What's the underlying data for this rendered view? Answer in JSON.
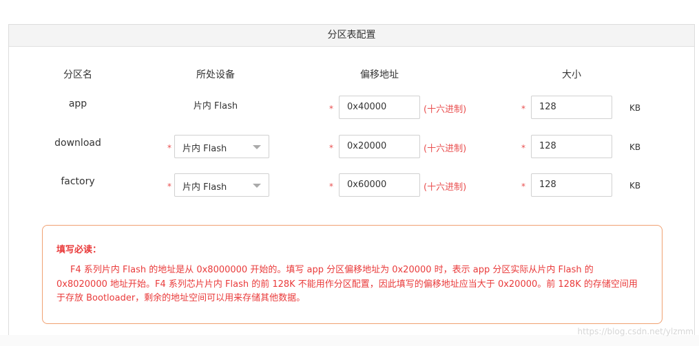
{
  "panel": {
    "title": "分区表配置"
  },
  "columns": {
    "name": "分区名",
    "device": "所处设备",
    "offset": "偏移地址",
    "size": "大小"
  },
  "rows": [
    {
      "name": "app",
      "device": "片内 Flash",
      "offset": "0x40000",
      "offset_hint": "(十六进制)",
      "size": "128",
      "unit": "KB"
    },
    {
      "name": "download",
      "device": "片内 Flash",
      "offset": "0x20000",
      "offset_hint": "(十六进制)",
      "size": "128",
      "unit": "KB"
    },
    {
      "name": "factory",
      "device": "片内 Flash",
      "offset": "0x60000",
      "offset_hint": "(十六进制)",
      "size": "128",
      "unit": "KB"
    }
  ],
  "required_mark": "*",
  "notice": {
    "title": "填写必读：",
    "body": "F4 系列片内 Flash 的地址是从 0x8000000 开始的。填写 app 分区偏移地址为 0x20000 时，表示 app 分区实际从片内 Flash 的 0x8020000 地址开始。F4 系列芯片片内 Flash 的前 128K 不能用作分区配置，因此填写的偏移地址应当大于 0x20000。前 128K 的存储空间用于存放 Bootloader，剩余的地址空间可以用来存储其他数据。"
  },
  "watermark": "https://blog.csdn.net/ylzmm",
  "icons": {
    "select_caret": "caret-down-icon"
  },
  "colors": {
    "required": "#e94e4e",
    "notice_border": "#f0a070",
    "notice_text": "#e93a3a"
  }
}
